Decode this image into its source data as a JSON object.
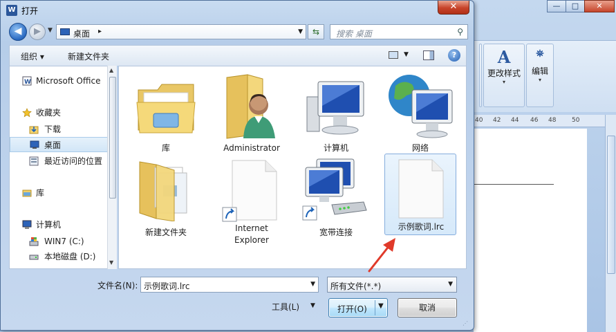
{
  "dialog": {
    "title": "打开",
    "title_icon": "W",
    "close_symbol": "✕"
  },
  "address": {
    "crumb": "桌面",
    "separator": "▸",
    "search_placeholder": "搜索 桌面"
  },
  "toolbar": {
    "organize": "组织 ▾",
    "new_folder": "新建文件夹",
    "help": "?"
  },
  "nav": {
    "items": [
      {
        "label": "Microsoft Office",
        "icon": "office-icon"
      },
      {
        "label": "收藏夹",
        "icon": "star-icon"
      },
      {
        "label": "下载",
        "icon": "download-folder-icon"
      },
      {
        "label": "桌面",
        "icon": "desktop-icon",
        "selected": true
      },
      {
        "label": "最近访问的位置",
        "icon": "recent-places-icon"
      },
      {
        "label": "库",
        "icon": "library-icon"
      },
      {
        "label": "计算机",
        "icon": "computer-icon"
      },
      {
        "label": "WIN7 (C:)",
        "icon": "system-drive-icon"
      },
      {
        "label": "本地磁盘 (D:)",
        "icon": "hard-drive-icon"
      }
    ]
  },
  "files": [
    {
      "label": "库",
      "icon": "library-folder-icon"
    },
    {
      "label": "Administrator",
      "icon": "user-folder-icon"
    },
    {
      "label": "计算机",
      "icon": "computer-icon"
    },
    {
      "label": "网络",
      "icon": "network-icon"
    },
    {
      "label": "新建文件夹",
      "icon": "folder-icon"
    },
    {
      "label_line1": "Internet",
      "label_line2": "Explorer",
      "icon": "shortcut-file-icon"
    },
    {
      "label": "宽带连接",
      "icon": "broadband-connection-icon"
    },
    {
      "label": "示例歌词.lrc",
      "icon": "blank-file-icon",
      "selected": true
    }
  ],
  "bottom": {
    "filename_label": "文件名(N):",
    "filename_value": "示例歌词.lrc",
    "filter_value": "所有文件(*.*)",
    "tools_label": "工具(L)",
    "open_label": "打开(O)",
    "cancel_label": "取消"
  },
  "background_word": {
    "ribbon_style_label": "更改样式",
    "ribbon_edit_label": "编辑",
    "ruler_ticks": [
      "40",
      "42",
      "44",
      "46",
      "48",
      "50"
    ],
    "window_buttons": [
      "—",
      "□",
      "✕"
    ]
  },
  "colors": {
    "arrow": "#e03a2a",
    "selection": "#d6e9fa",
    "close_button": "#c7432a"
  }
}
